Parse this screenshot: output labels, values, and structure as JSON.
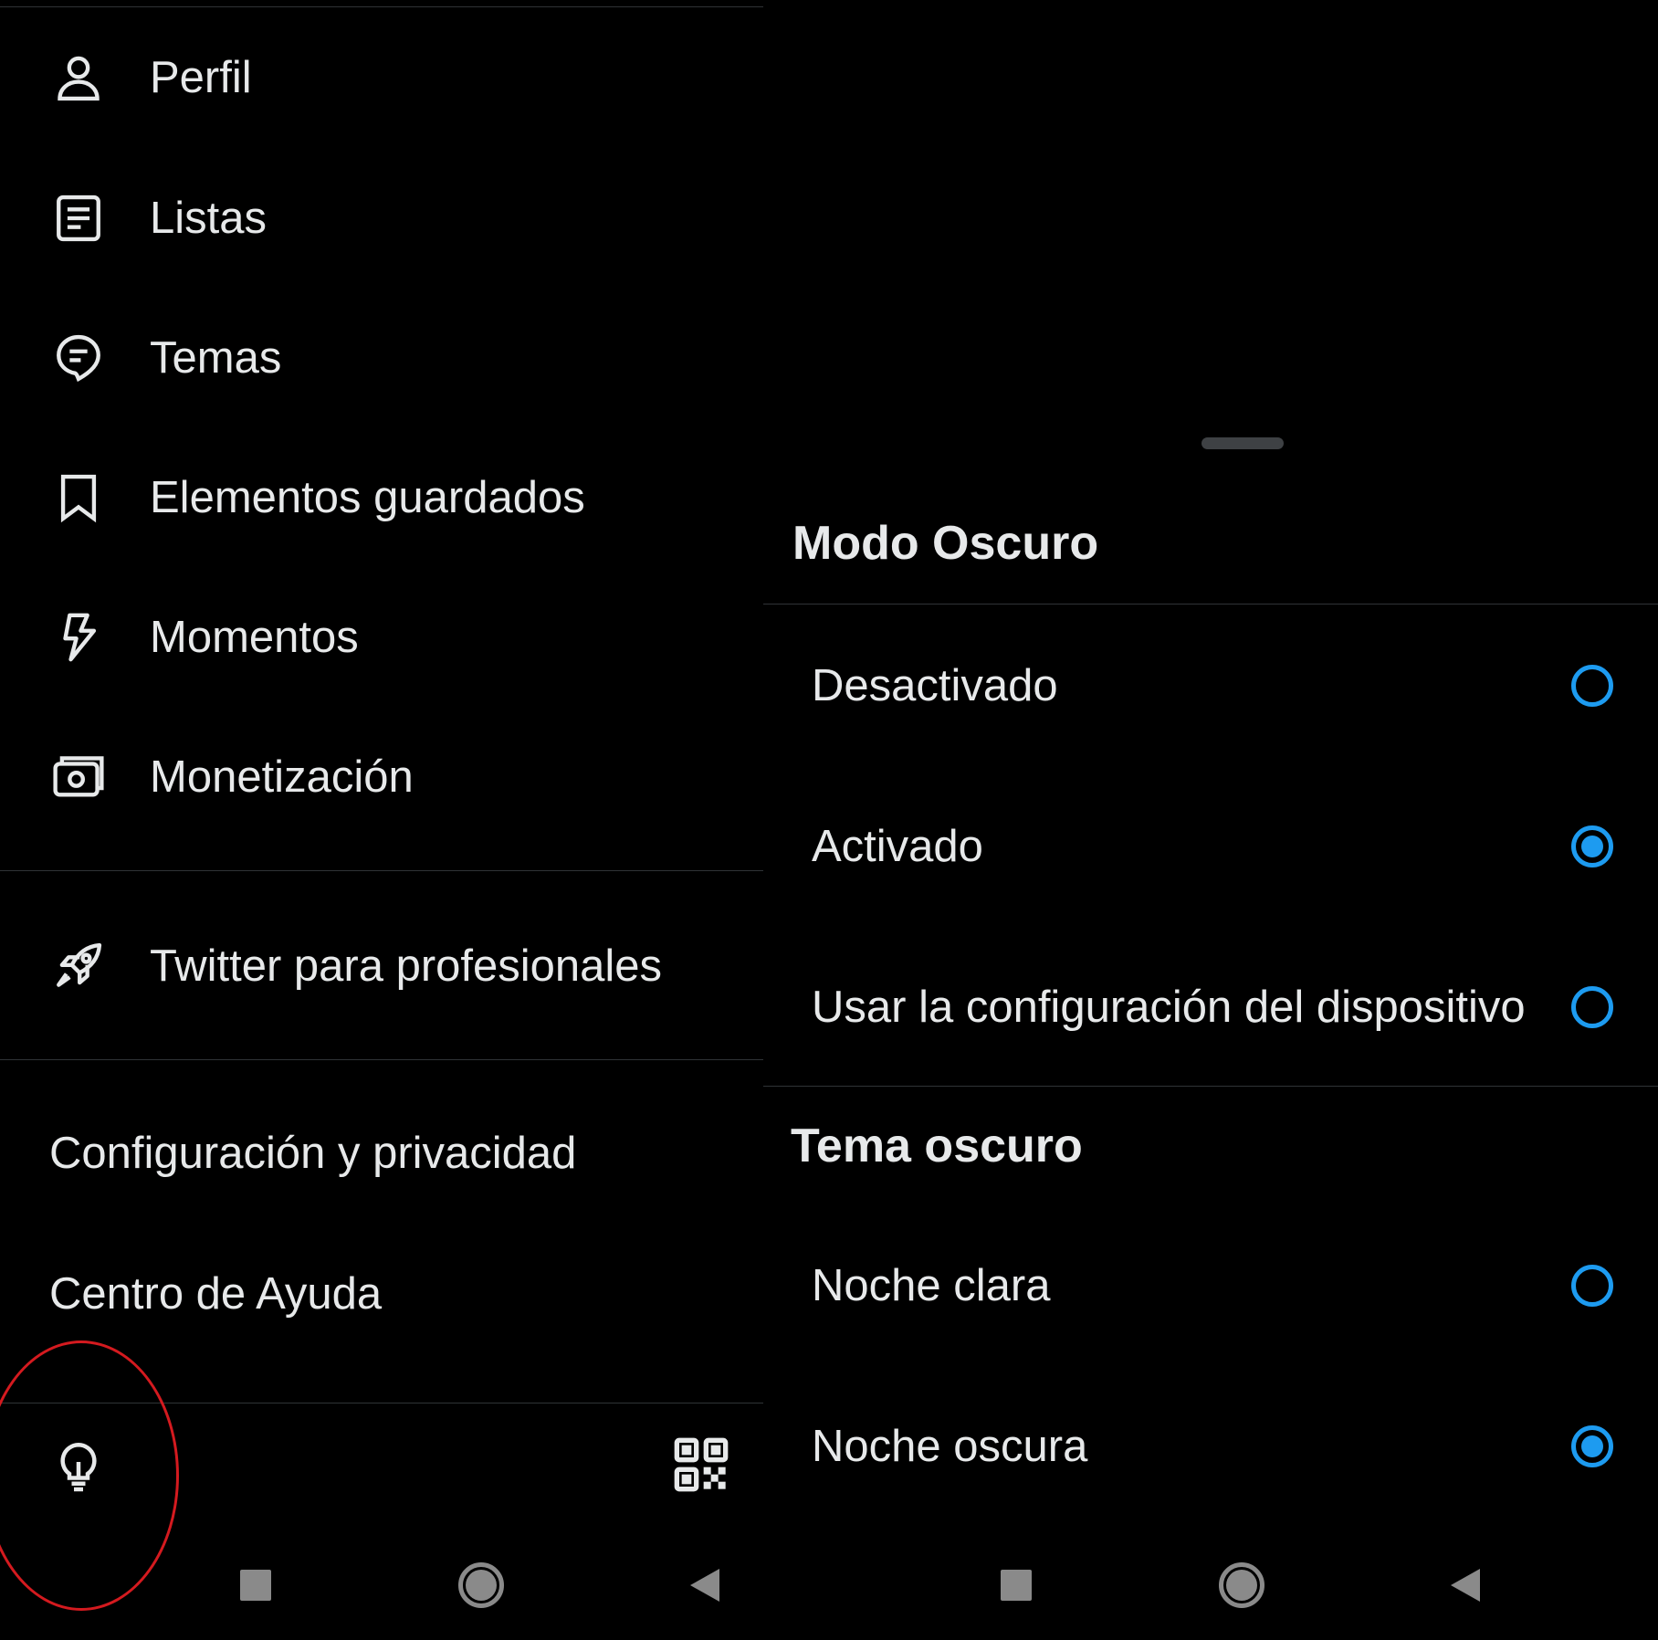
{
  "drawer": {
    "items": [
      {
        "label": "Perfil",
        "icon": "person-icon"
      },
      {
        "label": "Listas",
        "icon": "list-icon"
      },
      {
        "label": "Temas",
        "icon": "topics-icon"
      },
      {
        "label": "Elementos guardados",
        "icon": "bookmark-icon"
      },
      {
        "label": "Momentos",
        "icon": "lightning-icon"
      },
      {
        "label": "Monetización",
        "icon": "money-icon"
      }
    ],
    "professional": {
      "label": "Twitter para profesionales",
      "icon": "rocket-icon"
    },
    "settings_label": "Configuración y privacidad",
    "help_label": "Centro de Ayuda",
    "footer": {
      "left_icon": "lightbulb-icon",
      "right_icon": "qr-code-icon"
    }
  },
  "sheet": {
    "dark_mode": {
      "title": "Modo Oscuro",
      "options": [
        {
          "label": "Desactivado",
          "selected": false
        },
        {
          "label": "Activado",
          "selected": true
        },
        {
          "label": "Usar la configuración del dispositivo",
          "selected": false
        }
      ]
    },
    "dark_theme": {
      "title": "Tema oscuro",
      "options": [
        {
          "label": "Noche clara",
          "selected": false
        },
        {
          "label": "Noche oscura",
          "selected": true
        }
      ]
    }
  },
  "system_nav": [
    "recents-square-icon",
    "home-circle-icon",
    "back-triangle-icon"
  ],
  "colors": {
    "background": "#000000",
    "text": "#e7e9ea",
    "accent": "#1d9bf0",
    "divider": "#2f3336",
    "highlight": "#d41a1f"
  }
}
